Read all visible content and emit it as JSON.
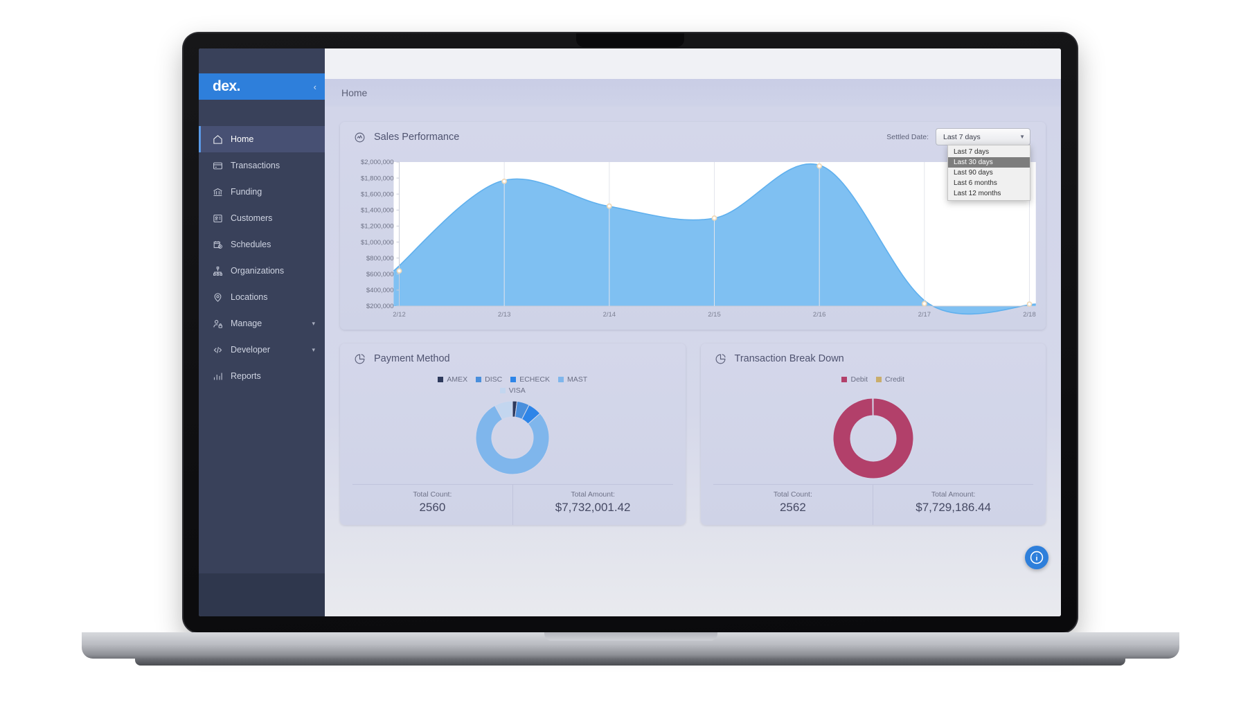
{
  "app": {
    "logo_text": "dex.",
    "collapse_icon": "chevron-left-icon",
    "breadcrumb": "Home"
  },
  "sidebar": {
    "items": [
      {
        "label": "Home",
        "icon": "home-icon",
        "active": true,
        "caret": false
      },
      {
        "label": "Transactions",
        "icon": "credit-card-icon",
        "active": false,
        "caret": false
      },
      {
        "label": "Funding",
        "icon": "bank-icon",
        "active": false,
        "caret": false
      },
      {
        "label": "Customers",
        "icon": "contact-card-icon",
        "active": false,
        "caret": false
      },
      {
        "label": "Schedules",
        "icon": "calendar-clock-icon",
        "active": false,
        "caret": false
      },
      {
        "label": "Organizations",
        "icon": "sitemap-icon",
        "active": false,
        "caret": false
      },
      {
        "label": "Locations",
        "icon": "map-pin-icon",
        "active": false,
        "caret": false
      },
      {
        "label": "Manage",
        "icon": "user-lock-icon",
        "active": false,
        "caret": true
      },
      {
        "label": "Developer",
        "icon": "code-icon",
        "active": false,
        "caret": true
      },
      {
        "label": "Reports",
        "icon": "bar-chart-icon",
        "active": false,
        "caret": false
      }
    ]
  },
  "sales_card": {
    "title": "Sales Performance",
    "icon": "activity-circle-icon",
    "filter": {
      "label": "Settled Date:",
      "selected": "Last 7 days",
      "caret_icon": "chevron-down-icon",
      "options": [
        "Last 7 days",
        "Last 30 days",
        "Last 90 days",
        "Last 6 months",
        "Last 12 months"
      ],
      "highlighted_option": "Last 30 days",
      "open": true
    }
  },
  "chart_data": [
    {
      "type": "area",
      "title": "Sales Performance",
      "xlabel": "",
      "ylabel": "",
      "x": [
        "2/12",
        "2/13",
        "2/14",
        "2/15",
        "2/16",
        "2/17",
        "2/18"
      ],
      "values": [
        640000,
        1760000,
        1450000,
        1300000,
        1950000,
        230000,
        225000
      ],
      "ylim": [
        200000,
        2000000
      ],
      "yticks": [
        200000,
        400000,
        600000,
        800000,
        1000000,
        1200000,
        1400000,
        1600000,
        1800000,
        2000000
      ],
      "ytick_labels": [
        "$200,000",
        "$400,000",
        "$600,000",
        "$800,000",
        "$1,000,000",
        "$1,200,000",
        "$1,400,000",
        "$1,600,000",
        "$1,800,000",
        "$2,000,000"
      ],
      "grid": true,
      "legend": "none",
      "colors": {
        "fill": "#7fc0f2",
        "line": "#5fb0ee",
        "marker": "#f0d9b8"
      }
    },
    {
      "type": "pie",
      "title": "Payment Method",
      "labels": [
        "AMEX",
        "DISC",
        "ECHECK",
        "MAST",
        "VISA"
      ],
      "values": [
        2.0,
        5.5,
        6.0,
        78.5,
        8.0
      ],
      "colors": [
        "#2e3a5c",
        "#4a8fdc",
        "#2e85e8",
        "#7fb6ec",
        "#c3d6ef"
      ],
      "legend": "top",
      "donut": true
    },
    {
      "type": "pie",
      "title": "Transaction Break Down",
      "labels": [
        "Debit",
        "Credit"
      ],
      "values": [
        99.7,
        0.3
      ],
      "colors": [
        "#b2406a",
        "#c9ad6b"
      ],
      "legend": "top",
      "donut": true
    }
  ],
  "payment_card": {
    "title": "Payment Method",
    "icon": "pie-chart-icon",
    "legend": [
      {
        "label": "AMEX",
        "color": "#2e3a5c"
      },
      {
        "label": "DISC",
        "color": "#4a8fdc"
      },
      {
        "label": "ECHECK",
        "color": "#2e85e8"
      },
      {
        "label": "MAST",
        "color": "#7fb6ec"
      },
      {
        "label": "VISA",
        "color": "#c3d6ef"
      }
    ],
    "total_count_label": "Total Count:",
    "total_count_value": "2560",
    "total_amount_label": "Total Amount:",
    "total_amount_value": "$7,732,001.42"
  },
  "transaction_card": {
    "title": "Transaction Break Down",
    "icon": "pie-chart-icon",
    "legend": [
      {
        "label": "Debit",
        "color": "#b2406a"
      },
      {
        "label": "Credit",
        "color": "#c9ad6b"
      }
    ],
    "total_count_label": "Total Count:",
    "total_count_value": "2562",
    "total_amount_label": "Total Amount:",
    "total_amount_value": "$7,729,186.44"
  },
  "help_fab": {
    "icon": "info-icon"
  },
  "theme": {
    "brand_blue": "#2e7fdb",
    "sidebar_dark": "#39415a",
    "card_bg": "#d1d5e8",
    "area_fill": "#7fc0f2"
  }
}
